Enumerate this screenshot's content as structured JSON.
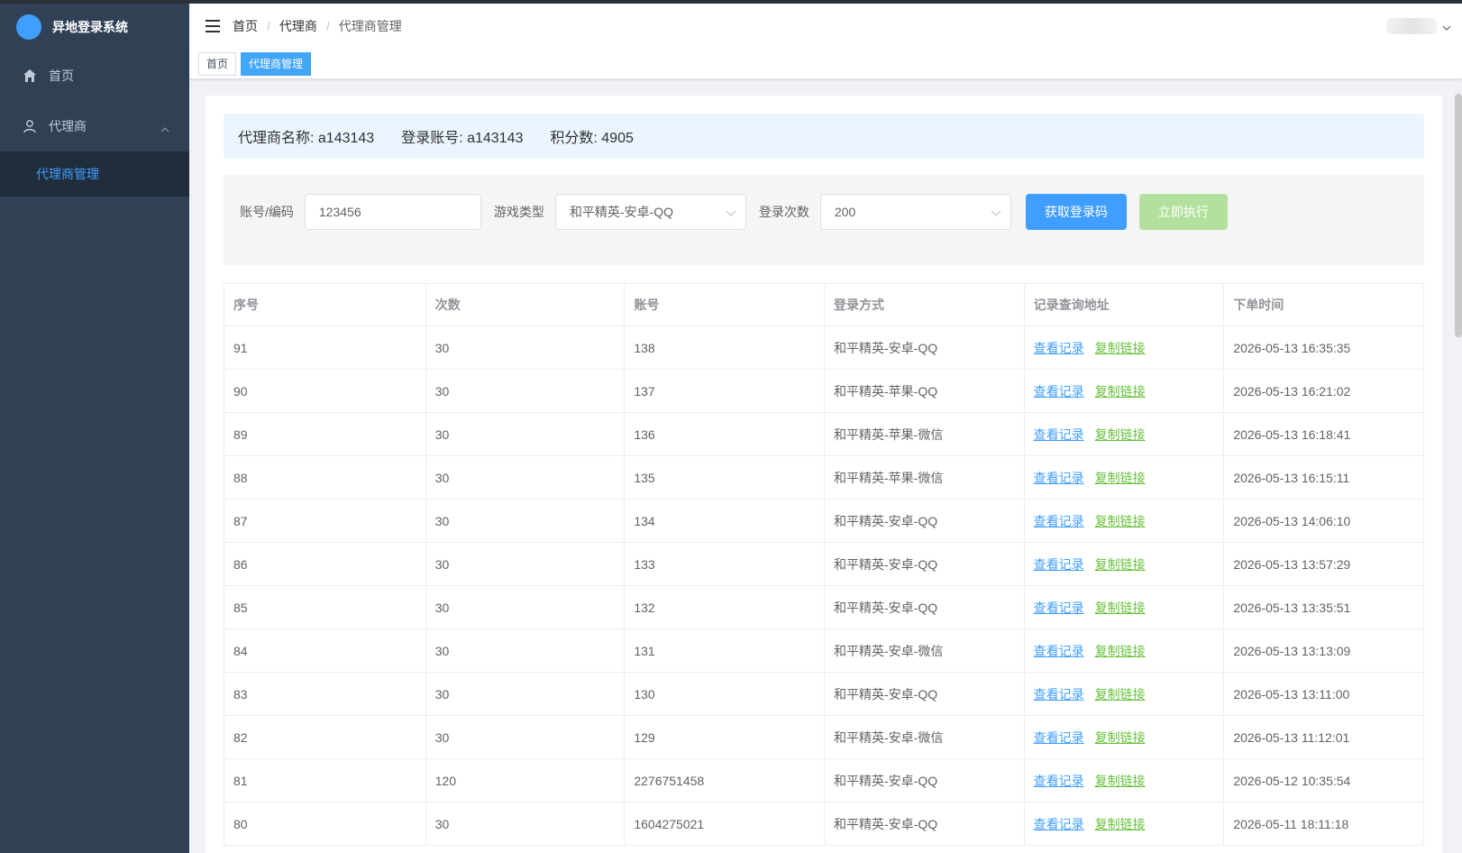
{
  "app": {
    "title": "异地登录系统"
  },
  "sidebar": {
    "items": [
      {
        "label": "首页"
      },
      {
        "label": "代理商",
        "children": [
          {
            "label": "代理商管理"
          }
        ]
      }
    ]
  },
  "navbar": {
    "breadcrumb": [
      "首页",
      "代理商",
      "代理商管理"
    ]
  },
  "tags": [
    "首页",
    "代理商管理"
  ],
  "info": {
    "name": "代理商名称: a143143",
    "account": "登录账号: a143143",
    "points": "积分数: 4905"
  },
  "filter": {
    "account_label": "账号/编码",
    "account_value": "123456",
    "game_label": "游戏类型",
    "game_value": "和平精英-安卓-QQ",
    "count_label": "登录次数",
    "count_value": "200",
    "get_code_button": "获取登录码",
    "execute_button": "立即执行"
  },
  "table": {
    "headers": [
      "序号",
      "次数",
      "账号",
      "登录方式",
      "记录查询地址",
      "下单时间"
    ],
    "view_link": "查看记录",
    "copy_link": "复制链接",
    "rows": [
      {
        "id": "91",
        "count": "30",
        "account": "138",
        "method": "和平精英-安卓-QQ",
        "time": "2026-05-13 16:35:35"
      },
      {
        "id": "90",
        "count": "30",
        "account": "137",
        "method": "和平精英-苹果-QQ",
        "time": "2026-05-13 16:21:02"
      },
      {
        "id": "89",
        "count": "30",
        "account": "136",
        "method": "和平精英-苹果-微信",
        "time": "2026-05-13 16:18:41"
      },
      {
        "id": "88",
        "count": "30",
        "account": "135",
        "method": "和平精英-苹果-微信",
        "time": "2026-05-13 16:15:11"
      },
      {
        "id": "87",
        "count": "30",
        "account": "134",
        "method": "和平精英-安卓-QQ",
        "time": "2026-05-13 14:06:10"
      },
      {
        "id": "86",
        "count": "30",
        "account": "133",
        "method": "和平精英-安卓-QQ",
        "time": "2026-05-13 13:57:29"
      },
      {
        "id": "85",
        "count": "30",
        "account": "132",
        "method": "和平精英-安卓-QQ",
        "time": "2026-05-13 13:35:51"
      },
      {
        "id": "84",
        "count": "30",
        "account": "131",
        "method": "和平精英-安卓-微信",
        "time": "2026-05-13 13:13:09"
      },
      {
        "id": "83",
        "count": "30",
        "account": "130",
        "method": "和平精英-安卓-QQ",
        "time": "2026-05-13 13:11:00"
      },
      {
        "id": "82",
        "count": "30",
        "account": "129",
        "method": "和平精英-安卓-微信",
        "time": "2026-05-13 11:12:01"
      },
      {
        "id": "81",
        "count": "120",
        "account": "2276751458",
        "method": "和平精英-安卓-QQ",
        "time": "2026-05-12 10:35:54"
      },
      {
        "id": "80",
        "count": "30",
        "account": "1604275021",
        "method": "和平精英-安卓-QQ",
        "time": "2026-05-11 18:11:18"
      }
    ]
  },
  "colors": {
    "sidebar_bg": "#304156",
    "primary": "#409eff",
    "success_disabled": "#b3e19d",
    "link_green": "#67c23a"
  }
}
